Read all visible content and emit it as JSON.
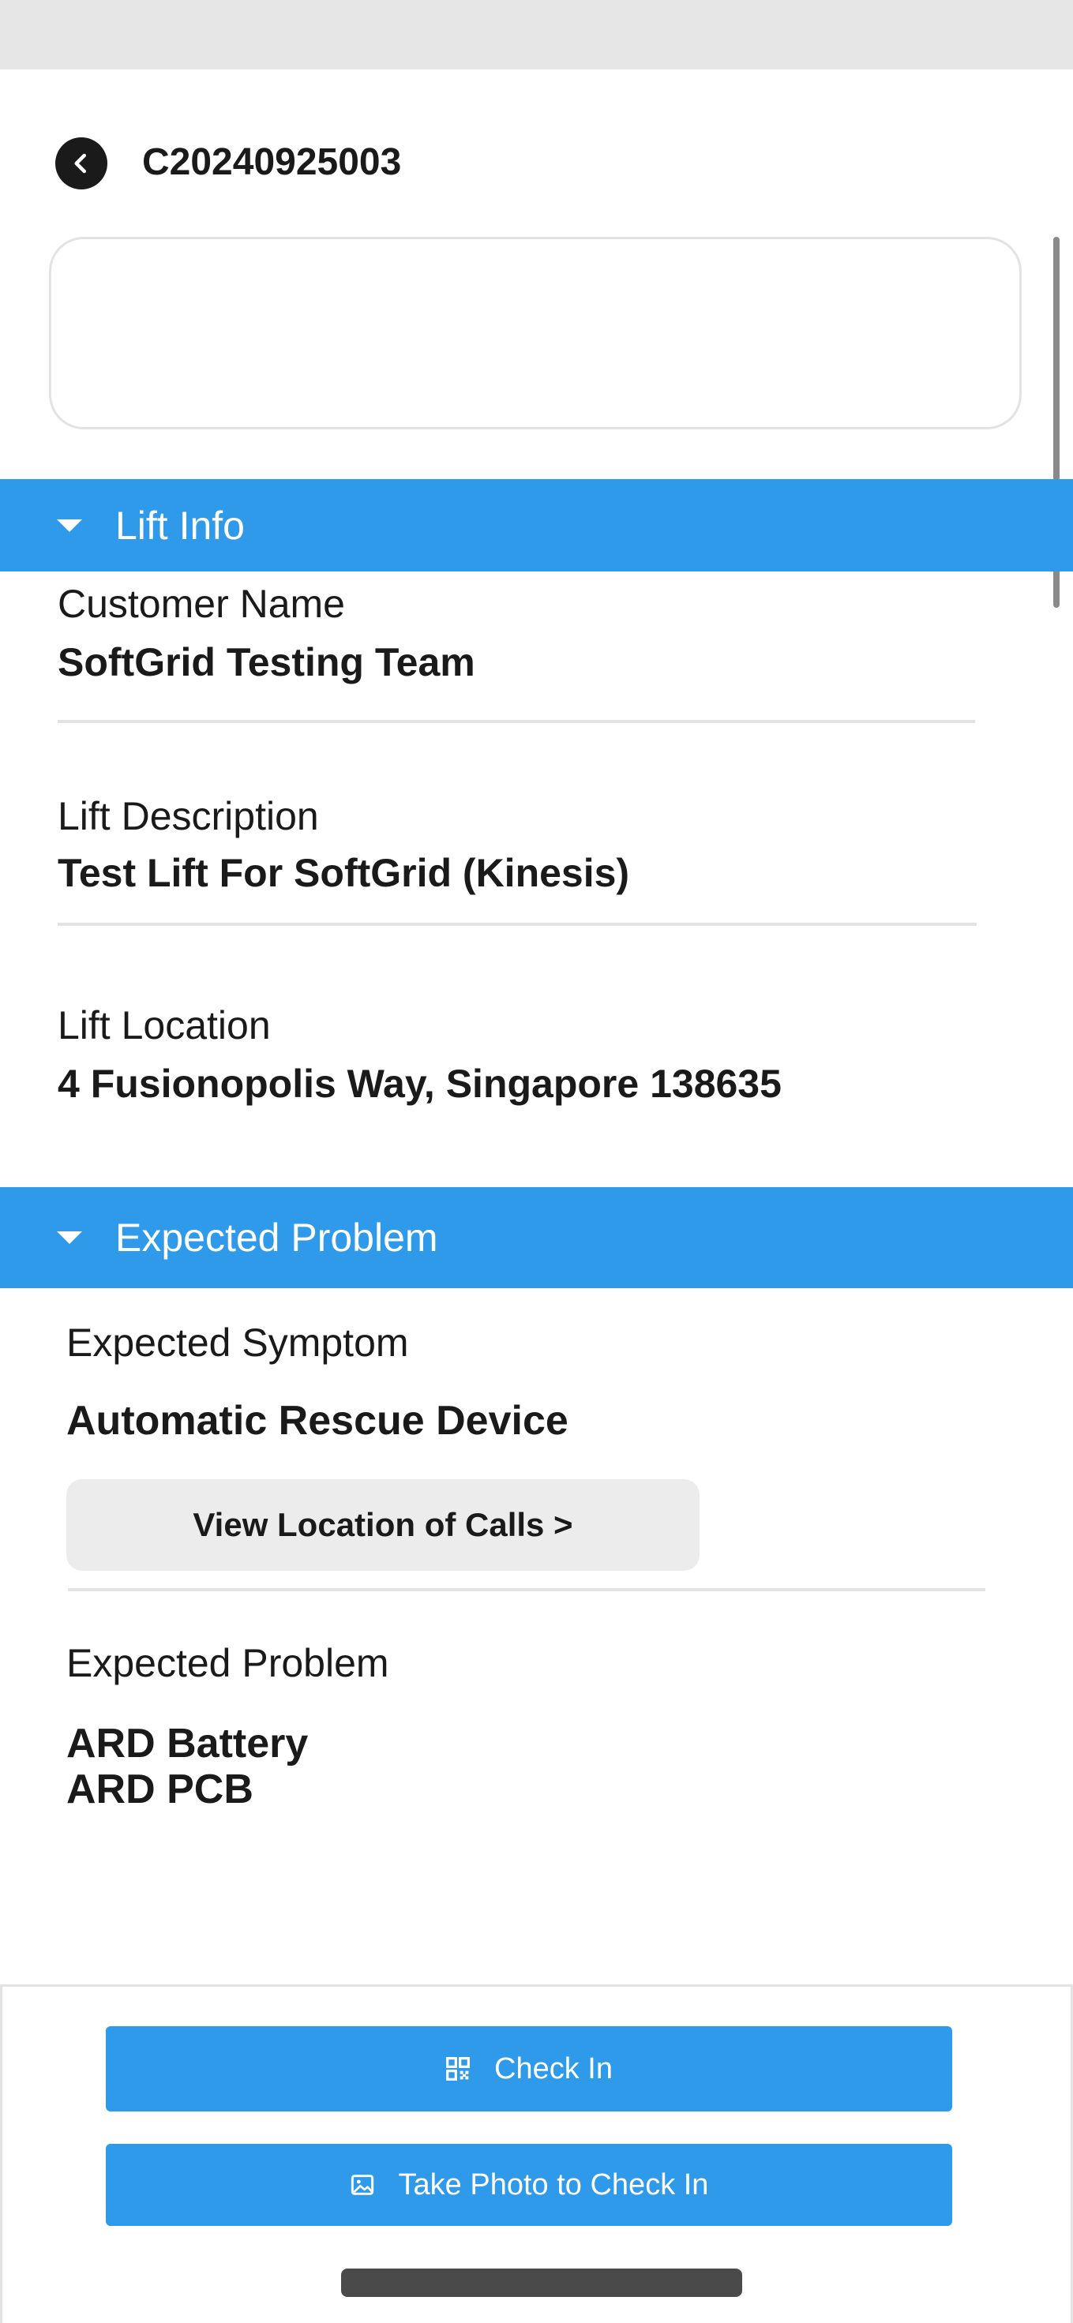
{
  "header": {
    "title": "C20240925003"
  },
  "lift_info": {
    "section_title": "Lift Info",
    "customer_name_label": "Customer Name",
    "customer_name_value": "SoftGrid Testing Team",
    "description_label": "Lift Description",
    "description_value": "Test Lift For SoftGrid (Kinesis)",
    "location_label": "Lift Location",
    "location_value": "4 Fusionopolis Way, Singapore 138635"
  },
  "expected_problem": {
    "section_title": "Expected Problem",
    "symptom_label": "Expected Symptom",
    "symptom_value": "Automatic Rescue Device",
    "view_calls_label": "View Location of Calls >",
    "problem_label": "Expected Problem",
    "problems": [
      "ARD Battery",
      "ARD PCB"
    ]
  },
  "footer": {
    "check_in_label": "Check In",
    "photo_check_in_label": "Take Photo to Check In"
  },
  "colors": {
    "accent": "#2f9aea",
    "secondary_button": "#ececec",
    "divider": "#e3e3e3"
  },
  "icons": {
    "back": "chevron-left-icon",
    "section_toggle": "caret-down-icon",
    "check_in": "qr-code-icon",
    "photo_check_in": "image-icon"
  }
}
